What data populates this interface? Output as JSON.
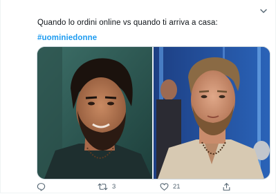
{
  "tweet": {
    "text": "Quando lo ordini online vs quando ti arriva a casa:",
    "hashtag": "#uominiedonne"
  },
  "media": {
    "left_image_alt": "",
    "right_image_alt": ""
  },
  "actions": {
    "reply_count": "",
    "retweet_count": "3",
    "like_count": "21"
  },
  "icons": {
    "reply": "reply-icon",
    "retweet": "retweet-icon",
    "like": "like-icon",
    "share": "share-icon",
    "more": "chevron-down-icon"
  },
  "colors": {
    "link": "#1d9bf0",
    "icon": "#536471",
    "border": "#cfd9de"
  }
}
